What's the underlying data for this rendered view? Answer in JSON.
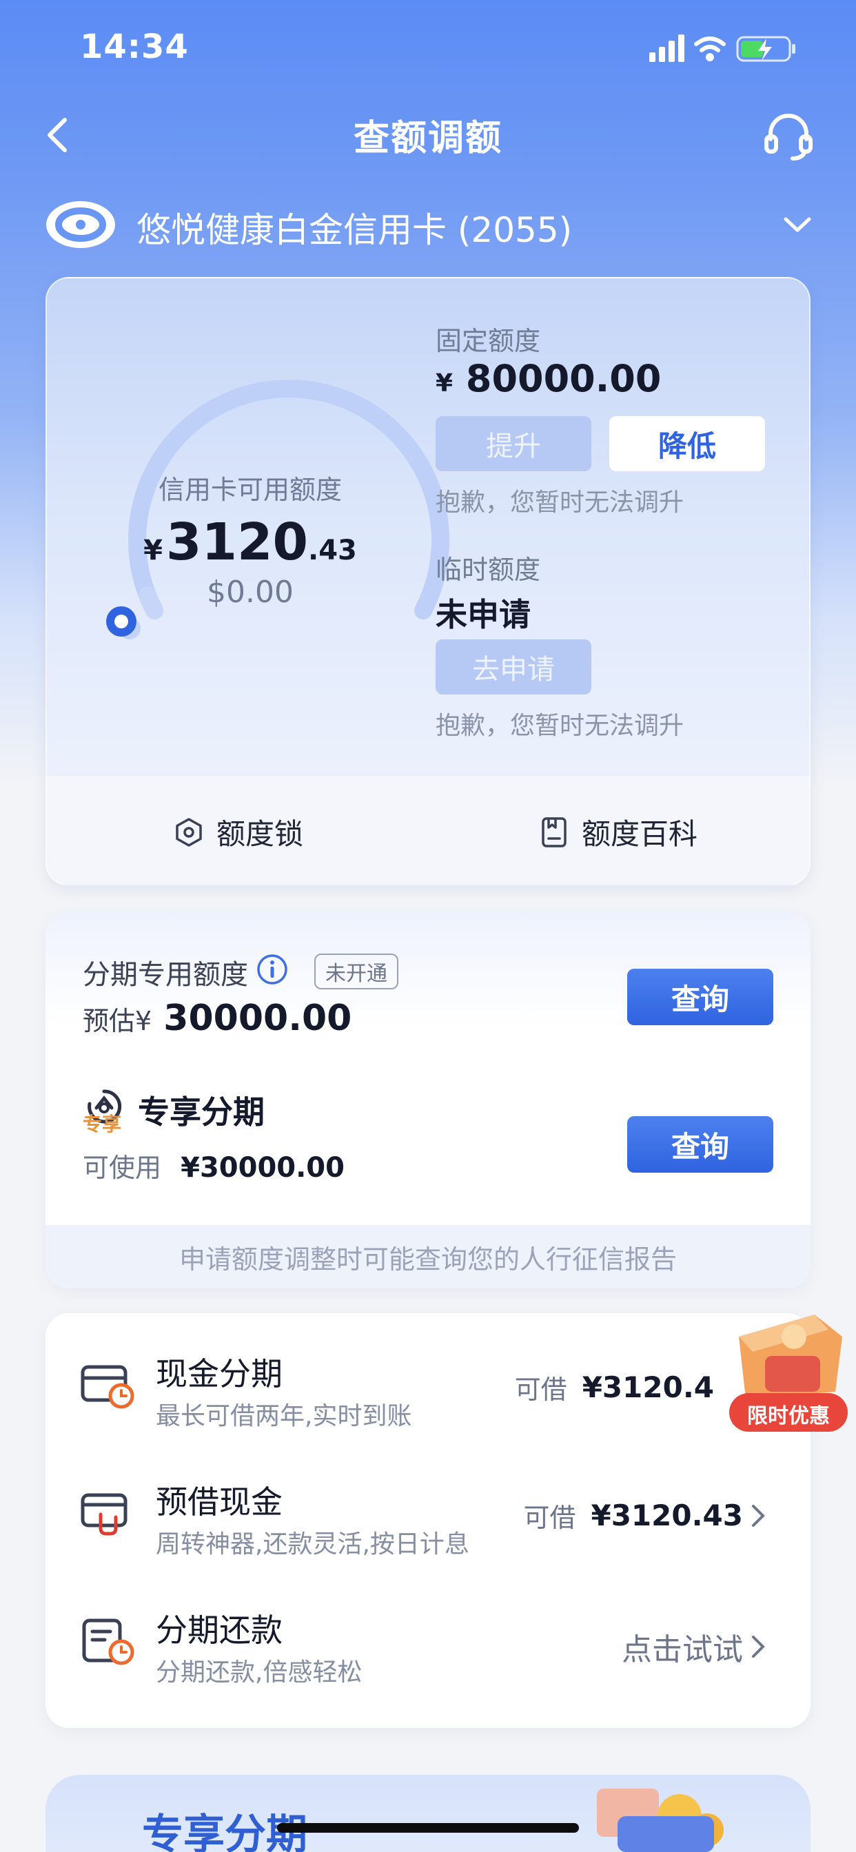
{
  "status_bar": {
    "time": "14:34"
  },
  "nav": {
    "title": "查额调额"
  },
  "card": {
    "name": "悠悦健康白金信用卡 (2055)"
  },
  "credit": {
    "gauge_label": "信用卡可用额度",
    "currency": "¥",
    "available_int": "3120",
    "available_dec": ".43",
    "usd_amount": "$0.00",
    "fixed_label": "固定额度",
    "fixed_amount": "80000.00",
    "raise_button": "提升",
    "lower_button": "降低",
    "fixed_note": "抱歉，您暂时无法调升",
    "temp_label": "临时额度",
    "temp_status": "未申请",
    "apply_button": "去申请",
    "temp_note": "抱歉，您暂时无法调升",
    "lock_label": "额度锁",
    "wiki_label": "额度百科"
  },
  "installment": {
    "title": "分期专用额度",
    "status_badge": "未开通",
    "estimate_prefix": "预估¥",
    "estimate_amount": "30000.00",
    "query_button": "查询",
    "exclusive_title": "专享分期",
    "exclusive_badge": "专享",
    "usable_prefix": "可使用",
    "usable_amount": "¥30000.00",
    "query_button_2": "查询",
    "footer_note": "申请额度调整时可能查询您的人行征信报告"
  },
  "services": [
    {
      "title": "现金分期",
      "subtitle": "最长可借两年,实时到账",
      "prefix": "可借",
      "amount": "¥3120.4"
    },
    {
      "title": "预借现金",
      "subtitle": "周转神器,还款灵活,按日计息",
      "prefix": "可借",
      "amount": "¥3120.43"
    },
    {
      "title": "分期还款",
      "subtitle": "分期还款,倍感轻松",
      "action": "点击试试"
    }
  ],
  "promo": {
    "label": "限时优惠"
  },
  "banner": {
    "title": "专享分期"
  },
  "gauge_fill_fraction": 0.0,
  "colors": {
    "primary": "#2f63e0",
    "header": "#5b8cf5",
    "promo_red": "#e8453b"
  }
}
